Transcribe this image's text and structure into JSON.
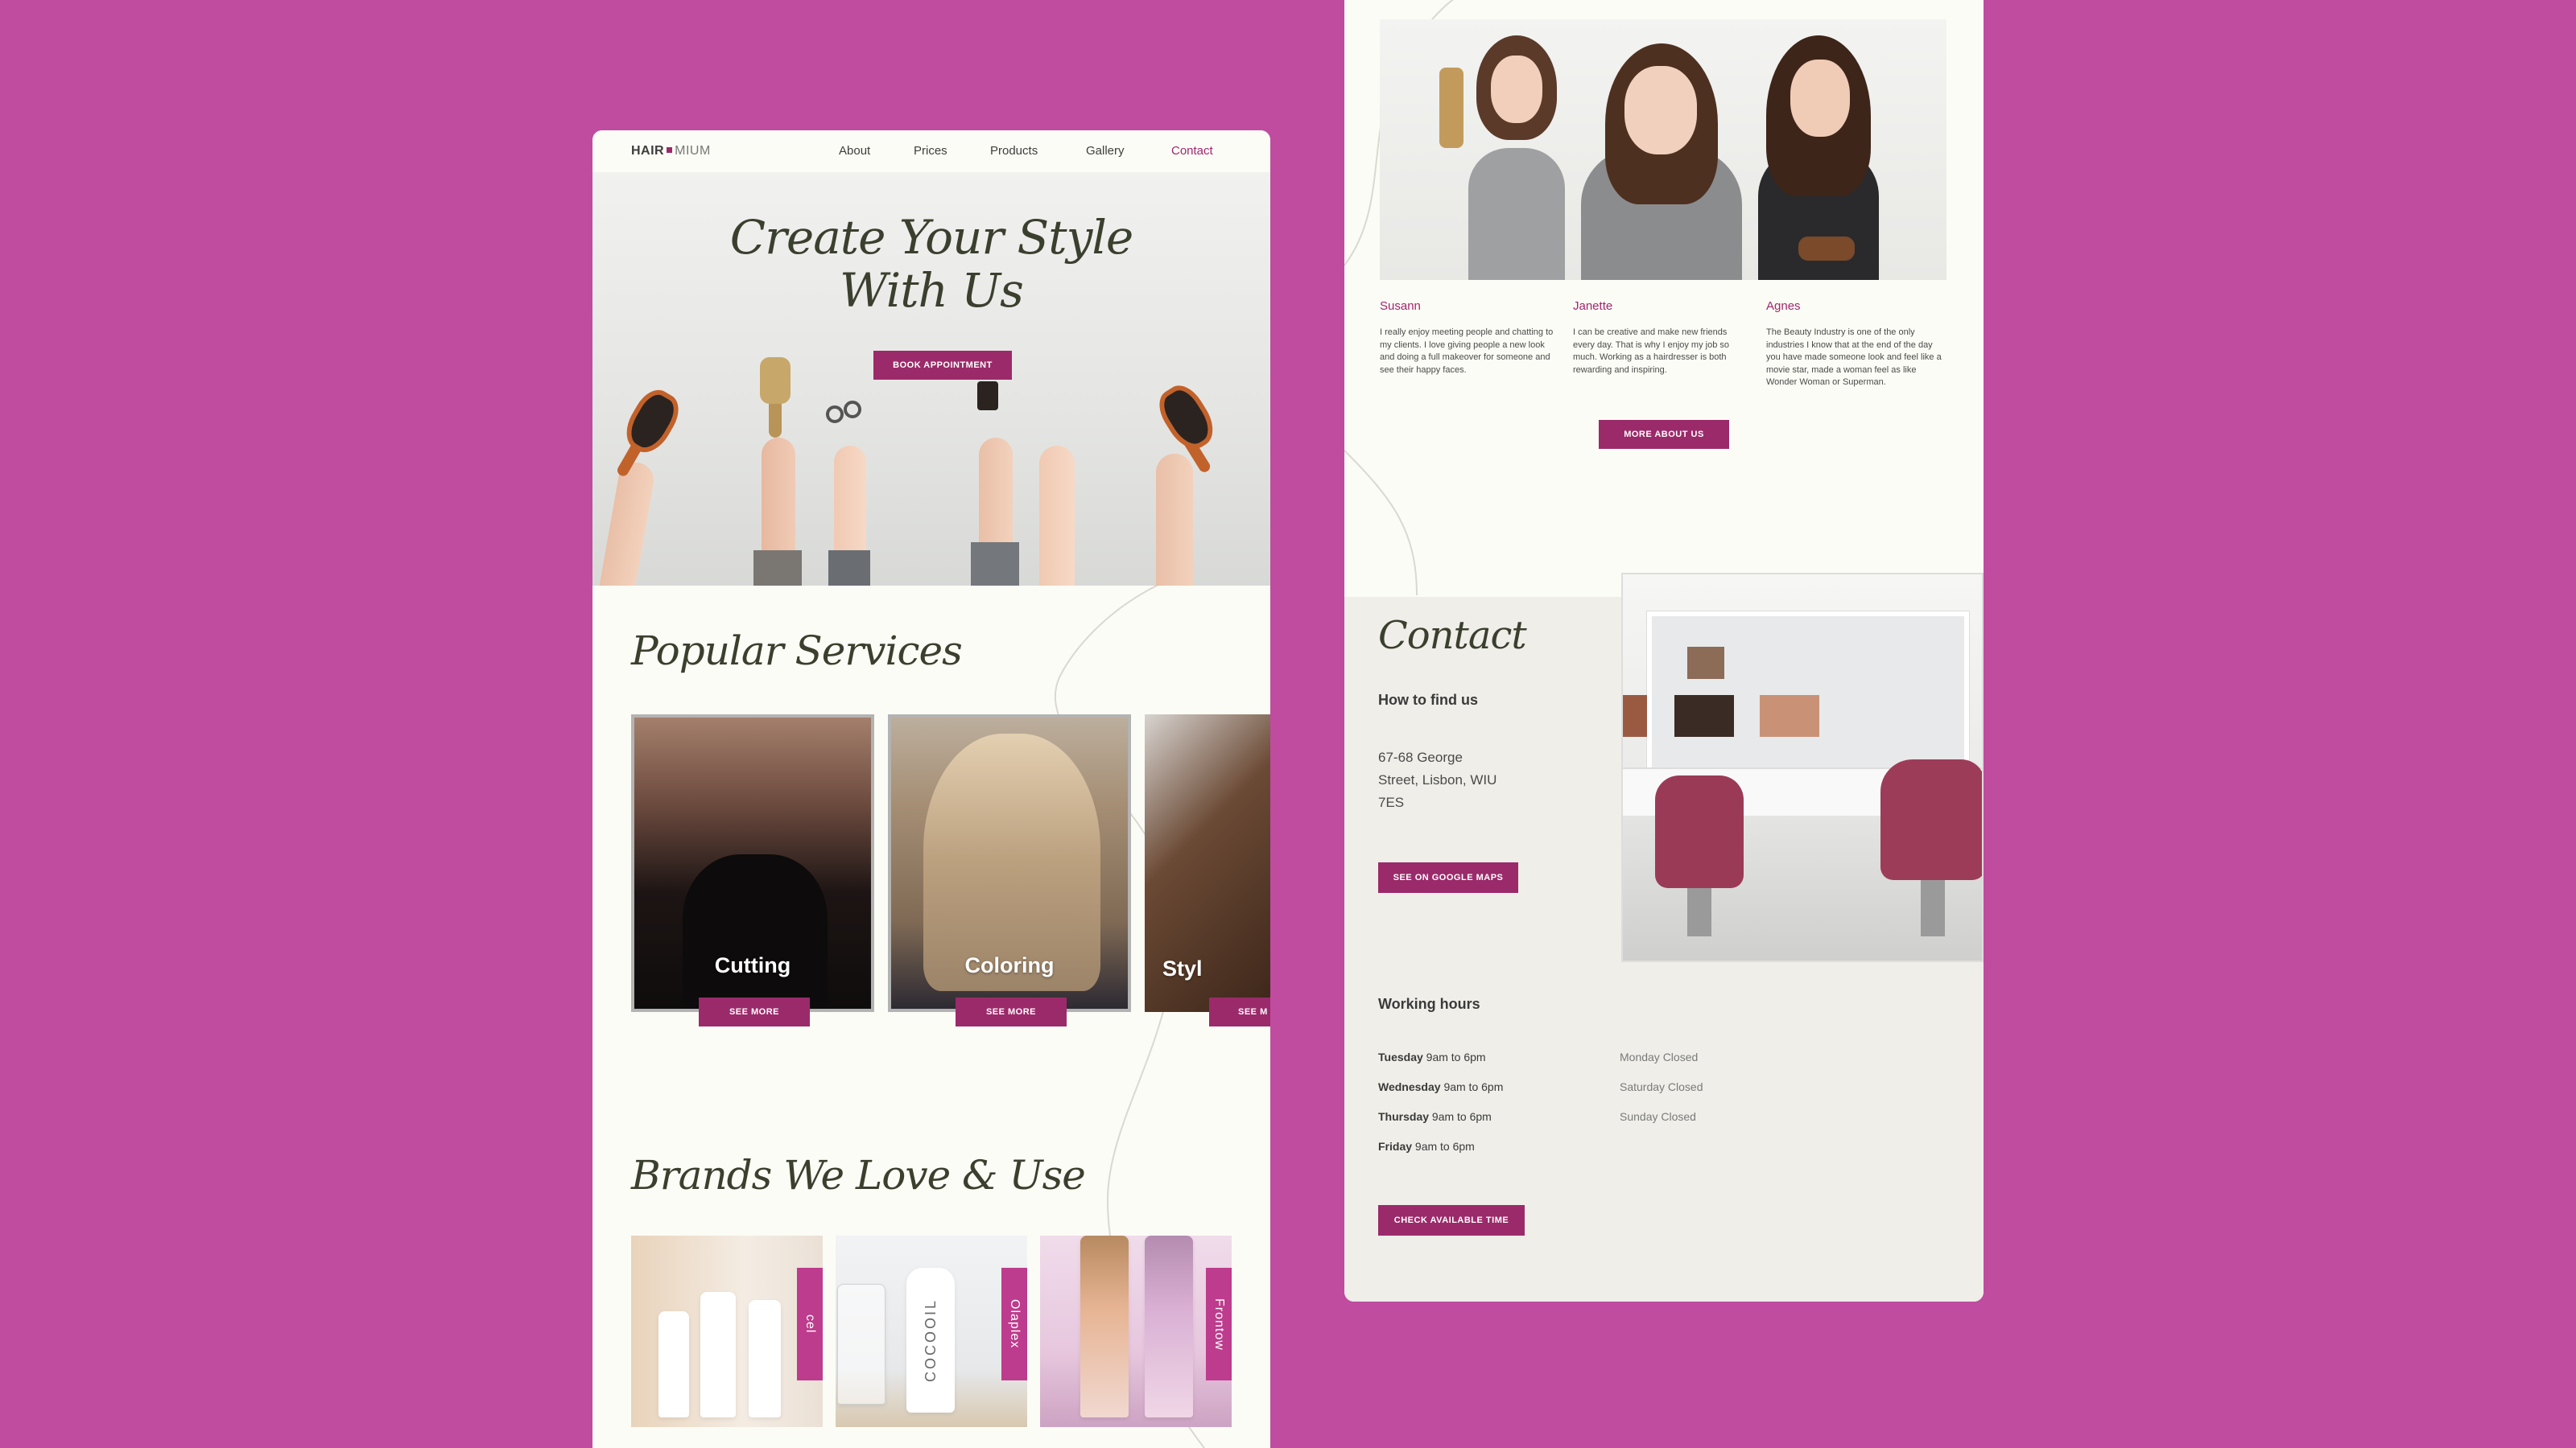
{
  "colors": {
    "background": "#bf4c9f",
    "accent": "#9b2a6a",
    "accent_text": "#a2266d",
    "page": "#fcfcf6",
    "contact_bg": "#efeee9"
  },
  "left_page": {
    "nav": {
      "logo_bold": "HAIR",
      "logo_thin": "MIUM",
      "links": [
        {
          "label": "About",
          "active": false
        },
        {
          "label": "Prices",
          "active": false
        },
        {
          "label": "Products",
          "active": false
        },
        {
          "label": "Gallery",
          "active": false
        },
        {
          "label": "Contact",
          "active": true
        }
      ]
    },
    "hero": {
      "title_line1": "Create Your Style",
      "title_line2": "With Us",
      "cta": "BOOK APPOINTMENT"
    },
    "services": {
      "title": "Popular Services",
      "items": [
        {
          "label": "Cutting",
          "button": "SEE MORE"
        },
        {
          "label": "Coloring",
          "button": "SEE MORE"
        },
        {
          "label": "Styl",
          "button": "SEE M"
        }
      ]
    },
    "brands": {
      "title": "Brands We Love & Use",
      "items": [
        {
          "tag": "cel"
        },
        {
          "tag": "Olaplex"
        },
        {
          "tag": "Frontow"
        }
      ],
      "bottle_label": "COCOOIL"
    }
  },
  "right_page": {
    "team": [
      {
        "name": "Susann",
        "bio": "I really enjoy meeting people and chatting to my clients. I love giving people a new look and doing a full makeover for someone and see their happy faces."
      },
      {
        "name": "Janette",
        "bio": "I can be creative and make new friends every day. That is why I enjoy my job so much. Working as a hairdresser is both rewarding and inspiring."
      },
      {
        "name": "Agnes",
        "bio": "The Beauty Industry is one of the only industries I know that at the end of the day you have made someone look and feel like a movie star, made a woman feel as like Wonder Woman or Superman."
      }
    ],
    "more_button": "MORE ABOUT US",
    "contact": {
      "title": "Contact",
      "find_heading": "How to find us",
      "address_line1": "67-68 George",
      "address_line2": "Street, Lisbon, WIU",
      "address_line3": "7ES",
      "maps_button": "SEE ON GOOGLE MAPS",
      "hours_heading": "Working hours",
      "open_days": [
        {
          "day": "Tuesday",
          "time": "9am to 6pm"
        },
        {
          "day": "Wednesday",
          "time": "9am to 6pm"
        },
        {
          "day": "Thursday",
          "time": "9am to 6pm"
        },
        {
          "day": "Friday",
          "time": "9am to 6pm"
        }
      ],
      "closed_days": [
        "Monday Closed",
        "Saturday Closed",
        "Sunday Closed"
      ],
      "check_button": "CHECK AVAILABLE TIME"
    }
  }
}
